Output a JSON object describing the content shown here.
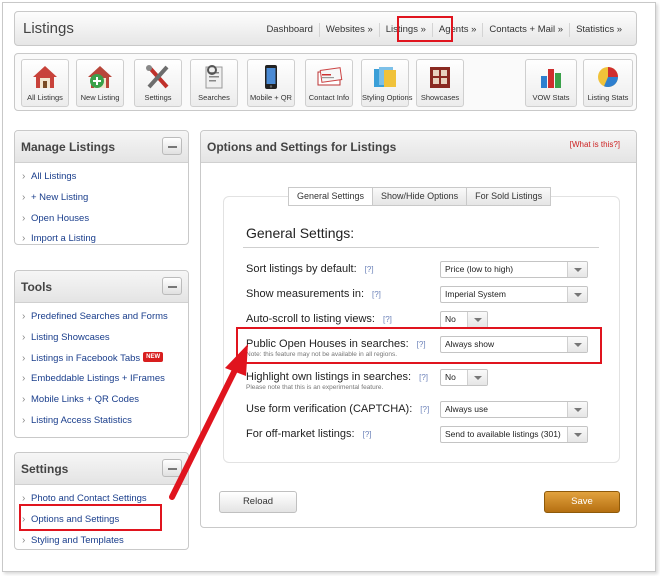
{
  "header": {
    "title": "Listings",
    "nav": [
      "Dashboard",
      "Websites »",
      "Listings »",
      "Agents »",
      "Contacts + Mail »",
      "Statistics »"
    ]
  },
  "toolbar": {
    "all_listings": "All Listings",
    "new_listing": "New Listing",
    "settings": "Settings",
    "searches": "Searches",
    "mobile_qr": "Mobile + QR",
    "contact_info": "Contact Info",
    "styling_options": "Styling Options",
    "showcases": "Showcases",
    "vow_stats": "VOW Stats",
    "listing_stats": "Listing Stats"
  },
  "sidebar": {
    "manage": {
      "title": "Manage Listings",
      "items": [
        "All Listings",
        "+ New Listing",
        "Open Houses",
        "Import a Listing"
      ]
    },
    "tools": {
      "title": "Tools",
      "items": [
        "Predefined Searches and Forms",
        "Listing Showcases",
        "Listings in Facebook Tabs",
        "Embeddable Listings + IFrames",
        "Mobile Links + QR Codes",
        "Listing Access Statistics"
      ],
      "new_badge": "NEW"
    },
    "settings": {
      "title": "Settings",
      "items": [
        "Photo and Contact Settings",
        "Options and Settings",
        "Styling and Templates"
      ]
    }
  },
  "main": {
    "title": "Options and Settings for Listings",
    "help": "[What is this?]",
    "tabs": [
      "General Settings",
      "Show/Hide Options",
      "For Sold Listings"
    ],
    "section_title": "General Settings:",
    "rows": [
      {
        "label": "Sort listings by default:",
        "q": "[?]",
        "value": "Price (low to high)"
      },
      {
        "label": "Show measurements in:",
        "q": "[?]",
        "value": "Imperial System"
      },
      {
        "label": "Auto-scroll to listing views:",
        "q": "[?]",
        "value": "No"
      },
      {
        "label": "Public Open Houses in searches:",
        "q": "[?]",
        "note": "Note: this feature may not be available in all regions.",
        "value": "Always show"
      },
      {
        "label": "Highlight own listings in searches:",
        "q": "[?]",
        "note": "Please note that this is an experimental feature.",
        "value": "No"
      },
      {
        "label": "Use form verification (CAPTCHA):",
        "q": "[?]",
        "value": "Always use"
      },
      {
        "label": "For off-market listings:",
        "q": "[?]",
        "value": "Send to available listings (301)"
      }
    ],
    "reload": "Reload",
    "save": "Save"
  },
  "colors": {
    "highlight": "#e0141e",
    "link": "#1a3e8c",
    "save": "#c98420"
  }
}
